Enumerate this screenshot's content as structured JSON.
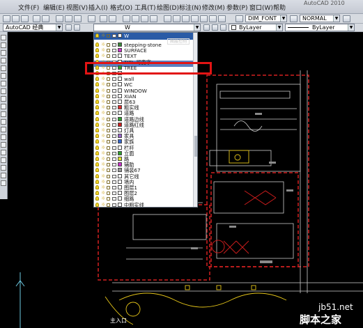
{
  "app": {
    "title_fragment": "AutoCAD 2010"
  },
  "menubar": {
    "items": [
      "文件(F)",
      "编辑(E)",
      "视图(V)",
      "插入(I)",
      "格式(O)",
      "工具(T)",
      "绘图(D)",
      "标注(N)",
      "修改(M)",
      "参数(P)",
      "窗口(W)",
      "帮助"
    ]
  },
  "toolbar": {
    "workspace": "AutoCAD 经典",
    "current_layer": "W",
    "dimstyle": "DIM_FONT",
    "tablestyle": "NORMAL",
    "color": "ByLayer",
    "linetype": "ByLayer"
  },
  "layer_dropdown": {
    "ghost_text": "图层控制",
    "layers": [
      {
        "name": "stepping-stone",
        "color": "#3a8a3a"
      },
      {
        "name": "SURFACE",
        "color": "#cc33cc"
      },
      {
        "name": "TEXT",
        "color": "#ffffff"
      },
      {
        "name": "TITL-可变字",
        "color": "#ffffff"
      },
      {
        "name": "TREE",
        "color": "#2fa12f"
      },
      {
        "name": "",
        "color": "#ffffff"
      },
      {
        "name": "wall",
        "color": "#ffffff"
      },
      {
        "name": "WC",
        "color": "#ffffff"
      },
      {
        "name": "WINDOW",
        "color": "#ffffff"
      },
      {
        "name": "XIAN",
        "color": "#ffffff"
      },
      {
        "name": "层63",
        "color": "#ffffff"
      },
      {
        "name": "粗实线",
        "color": "#e03030"
      },
      {
        "name": "道路",
        "color": "#ffffff"
      },
      {
        "name": "道路边线",
        "color": "#30a030"
      },
      {
        "name": "道路红线",
        "color": "#d02020"
      },
      {
        "name": "灯具",
        "color": "#ffffff"
      },
      {
        "name": "家具",
        "color": "#9966cc"
      },
      {
        "name": "家族",
        "color": "#3366cc"
      },
      {
        "name": "栏杆",
        "color": "#ffffff"
      },
      {
        "name": "立面",
        "color": "#30a030"
      },
      {
        "name": "路",
        "color": "#e0e030"
      },
      {
        "name": "辅助",
        "color": "#cc33cc"
      },
      {
        "name": "铺装67",
        "color": "#999999"
      },
      {
        "name": "其它线",
        "color": "#ffffff"
      },
      {
        "name": "墙内",
        "color": "#ffffff"
      },
      {
        "name": "图层1",
        "color": "#ffffff"
      },
      {
        "name": "图层2",
        "color": "#ffffff"
      },
      {
        "name": "细路",
        "color": "#ffffff"
      },
      {
        "name": "中粗实线",
        "color": "#ffffff"
      },
      {
        "name": "主道路",
        "color": "#ffffff"
      }
    ]
  },
  "drawing": {
    "entrance_label": "主入口",
    "watermark_site": "jb51.net",
    "watermark_brand": "脚本之家"
  }
}
